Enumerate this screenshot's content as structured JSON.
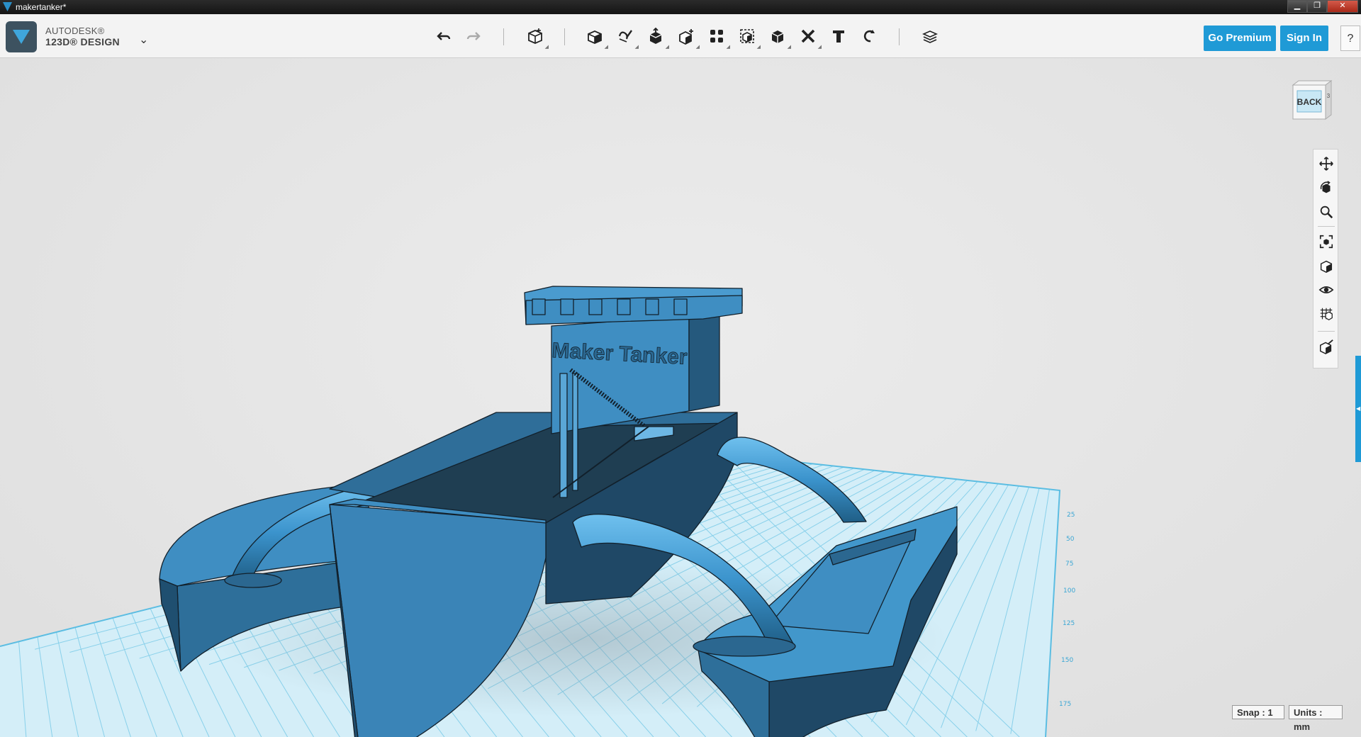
{
  "window": {
    "title": "makertanker*",
    "minimize_glyph": "▁",
    "restore_glyph": "❐",
    "close_glyph": "✕"
  },
  "app": {
    "brand_line1": "AUTODESK®",
    "brand_line2": "123D® DESIGN",
    "menu_caret": "⌄"
  },
  "toolbar": {
    "tools": [
      "undo-icon",
      "redo-icon",
      "primitives-icon",
      "sketch-icon",
      "construct-icon",
      "modify-icon",
      "pattern-icon",
      "grouping-icon",
      "combine-icon",
      "measure-icon",
      "text-icon",
      "snap-icon",
      "material-icon"
    ],
    "go_premium_label": "Go Premium",
    "sign_in_label": "Sign In",
    "help_label": "?"
  },
  "viewcube": {
    "face_label": "BACK",
    "side_digit": "3"
  },
  "navbar": {
    "tools": [
      "pan-icon",
      "orbit-icon",
      "zoom-icon",
      "fit-icon",
      "views-icon",
      "visibility-icon",
      "grid-display-icon",
      "material-display-icon"
    ]
  },
  "model": {
    "label": "Maker Tanker"
  },
  "grid": {
    "ruler_labels": [
      "25",
      "50",
      "75",
      "100",
      "125",
      "150",
      "175"
    ]
  },
  "status": {
    "snap_label": "Snap : 1",
    "units_label": "Units : mm"
  },
  "colors": {
    "accent": "#1f9ad6",
    "model_blue": "#3f8ec2",
    "grid_line": "#7ccbe8",
    "grid_fill": "#d2eef8"
  }
}
